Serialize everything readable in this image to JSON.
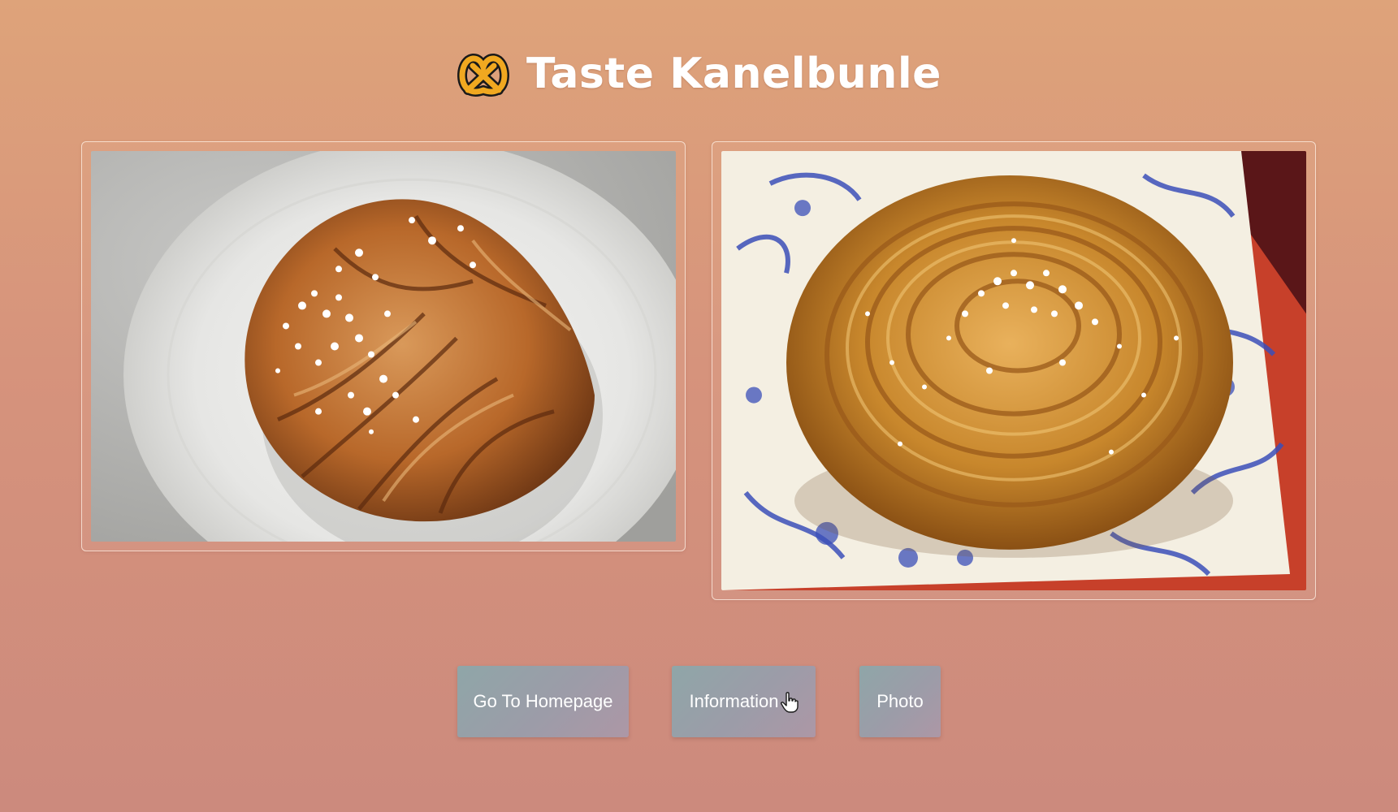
{
  "header": {
    "title": "Taste Kanelbunle",
    "logo_icon": "pretzel-icon"
  },
  "gallery": {
    "photos": [
      {
        "subject": "cardamom-twist-bun"
      },
      {
        "subject": "cinnamon-roll-bun"
      }
    ]
  },
  "buttons": {
    "home_label": "Go To Homepage",
    "info_label": "Information",
    "photo_label": "Photo"
  },
  "colors": {
    "background_top": "#dea37a",
    "background_bottom": "#cc8a7d",
    "button_start": "#8fa6a8",
    "button_end": "#ad97a6",
    "title": "#ffffff"
  }
}
